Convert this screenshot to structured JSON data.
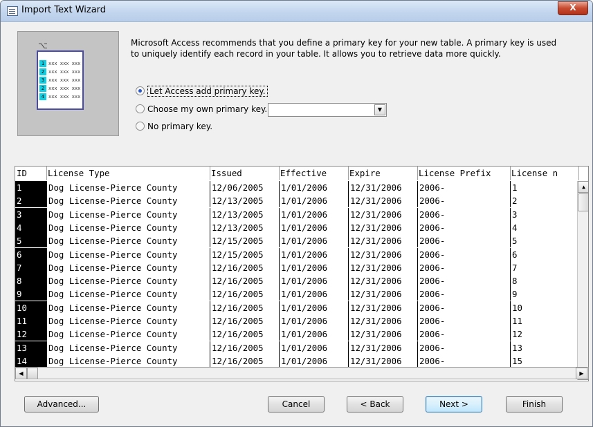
{
  "window": {
    "title": "Import Text Wizard",
    "close_glyph": "X"
  },
  "illustration": {
    "key_glyph": "⌥",
    "rows": [
      {
        "num": "1",
        "text": "xxx xxx xxx"
      },
      {
        "num": "2",
        "text": "xxx xxx xxx"
      },
      {
        "num": "3",
        "text": "xxx xxx xxx"
      },
      {
        "num": "2",
        "text": "xxx xxx xxx"
      },
      {
        "num": "4",
        "text": "xxx xxx xxx"
      }
    ]
  },
  "description": "Microsoft Access recommends that you define a primary key for your new table. A primary key is used to uniquely identify each record in your table. It allows you to retrieve data more quickly.",
  "options": [
    {
      "label": "Let Access add primary key.",
      "selected": true
    },
    {
      "label": "Choose my own primary key.",
      "selected": false
    },
    {
      "label": "No primary key.",
      "selected": false
    }
  ],
  "primary_key_combo": {
    "value": "",
    "arrow_icon": "dropdown-arrow-icon"
  },
  "table": {
    "columns": [
      "ID",
      "License Type",
      "Issued",
      "Effective",
      "Expire",
      "License Prefix",
      "License n"
    ],
    "rows": [
      [
        "1",
        "Dog License-Pierce County",
        "12/06/2005",
        "1/01/2006",
        "12/31/2006",
        "2006-",
        "1"
      ],
      [
        "2",
        "Dog License-Pierce County",
        "12/13/2005",
        "1/01/2006",
        "12/31/2006",
        "2006-",
        "2"
      ],
      [
        "3",
        "Dog License-Pierce County",
        "12/13/2005",
        "1/01/2006",
        "12/31/2006",
        "2006-",
        "3"
      ],
      [
        "4",
        "Dog License-Pierce County",
        "12/13/2005",
        "1/01/2006",
        "12/31/2006",
        "2006-",
        "4"
      ],
      [
        "5",
        "Dog License-Pierce County",
        "12/15/2005",
        "1/01/2006",
        "12/31/2006",
        "2006-",
        "5"
      ],
      [
        "6",
        "Dog License-Pierce County",
        "12/15/2005",
        "1/01/2006",
        "12/31/2006",
        "2006-",
        "6"
      ],
      [
        "7",
        "Dog License-Pierce County",
        "12/16/2005",
        "1/01/2006",
        "12/31/2006",
        "2006-",
        "7"
      ],
      [
        "8",
        "Dog License-Pierce County",
        "12/16/2005",
        "1/01/2006",
        "12/31/2006",
        "2006-",
        "8"
      ],
      [
        "9",
        "Dog License-Pierce County",
        "12/16/2005",
        "1/01/2006",
        "12/31/2006",
        "2006-",
        "9"
      ],
      [
        "10",
        "Dog License-Pierce County",
        "12/16/2005",
        "1/01/2006",
        "12/31/2006",
        "2006-",
        "10"
      ],
      [
        "11",
        "Dog License-Pierce County",
        "12/16/2005",
        "1/01/2006",
        "12/31/2006",
        "2006-",
        "11"
      ],
      [
        "12",
        "Dog License-Pierce County",
        "12/16/2005",
        "1/01/2006",
        "12/31/2006",
        "2006-",
        "12"
      ],
      [
        "13",
        "Dog License-Pierce County",
        "12/16/2005",
        "1/01/2006",
        "12/31/2006",
        "2006-",
        "13"
      ],
      [
        "14",
        "Dog License-Pierce County",
        "12/16/2005",
        "1/01/2006",
        "12/31/2006",
        "2006-",
        "15"
      ]
    ]
  },
  "scrollbar_icons": {
    "up": "▲",
    "down": "▼",
    "left": "◀",
    "right": "▶"
  },
  "buttons": {
    "advanced": "Advanced...",
    "cancel": "Cancel",
    "back": "< Back",
    "next": "Next >",
    "finish": "Finish"
  }
}
